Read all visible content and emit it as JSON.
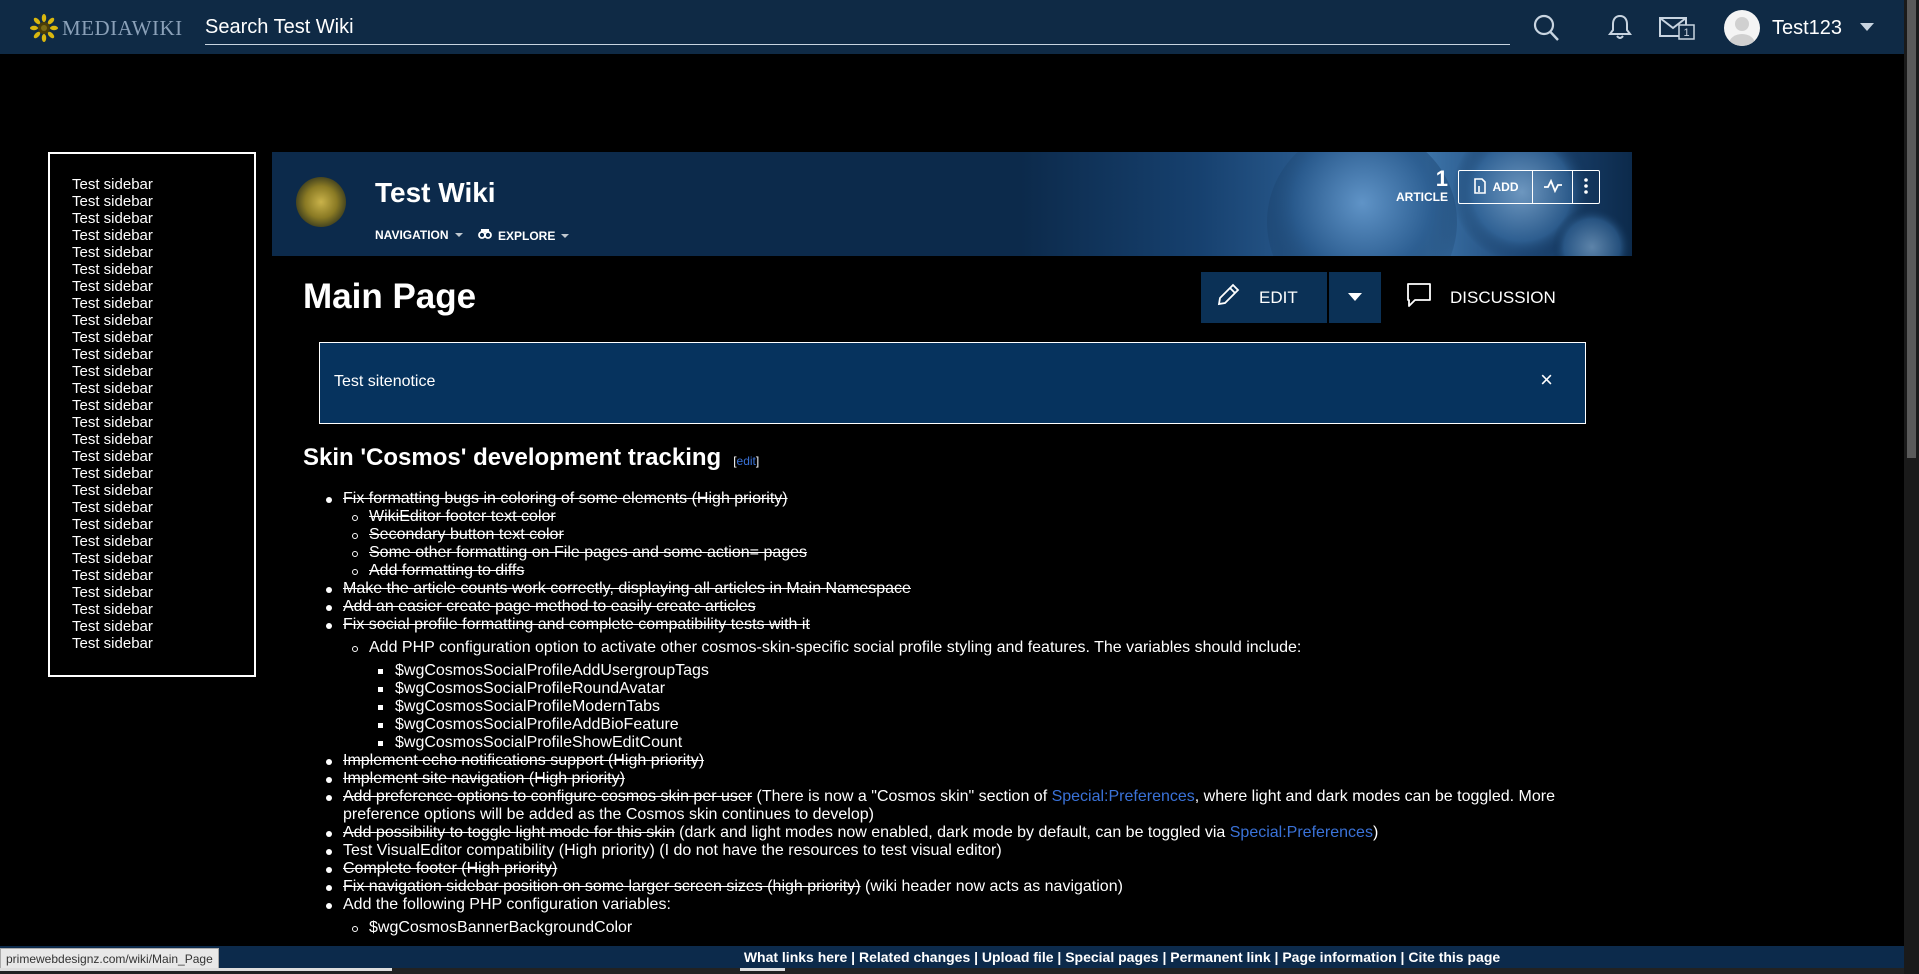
{
  "topbar": {
    "logo_text": "MEDIAWIKI",
    "search_placeholder": "Search Test Wiki",
    "username": "Test123",
    "notices_badge": "1",
    "icons": [
      "search-icon",
      "bell-icon",
      "mail-icon",
      "avatar",
      "chevron-down-icon"
    ]
  },
  "sidebar": {
    "items": [
      "Test sidebar",
      "Test sidebar",
      "Test sidebar",
      "Test sidebar",
      "Test sidebar",
      "Test sidebar",
      "Test sidebar",
      "Test sidebar",
      "Test sidebar",
      "Test sidebar",
      "Test sidebar",
      "Test sidebar",
      "Test sidebar",
      "Test sidebar",
      "Test sidebar",
      "Test sidebar",
      "Test sidebar",
      "Test sidebar",
      "Test sidebar",
      "Test sidebar",
      "Test sidebar",
      "Test sidebar",
      "Test sidebar",
      "Test sidebar",
      "Test sidebar",
      "Test sidebar",
      "Test sidebar",
      "Test sidebar"
    ]
  },
  "wiki_header": {
    "title": "Test Wiki",
    "nav_label": "NAVIGATION",
    "explore_label": "EXPLORE",
    "article_count": "1",
    "article_label": "ARTICLE",
    "add_label": "ADD"
  },
  "page": {
    "title": "Main Page",
    "edit_label": "EDIT",
    "discussion_label": "DISCUSSION",
    "sitenotice": "Test sitenotice",
    "notice_close": "×",
    "section_heading": "Skin 'Cosmos' development tracking",
    "editsection_open": "[",
    "editsection_link": "edit",
    "editsection_close": "]"
  },
  "content": {
    "items": [
      {
        "level": 1,
        "parts": [
          {
            "t": "Fix formatting bugs in coloring of some elements (High priority)",
            "s": true
          }
        ]
      },
      {
        "level": 2,
        "parts": [
          {
            "t": "WikiEditor footer text color",
            "s": true
          }
        ]
      },
      {
        "level": 2,
        "parts": [
          {
            "t": "Secondary button text color",
            "s": true
          }
        ]
      },
      {
        "level": 2,
        "parts": [
          {
            "t": "Some other formatting on File pages and some action= pages",
            "s": true
          }
        ]
      },
      {
        "level": 2,
        "parts": [
          {
            "t": "Add formatting to diffs",
            "s": true
          }
        ]
      },
      {
        "level": 1,
        "parts": [
          {
            "t": "Make the article counts work correctly, displaying all articles in Main Namespace",
            "s": true
          }
        ]
      },
      {
        "level": 1,
        "parts": [
          {
            "t": "Add an easier create page method to easily create articles",
            "s": true
          }
        ]
      },
      {
        "level": 1,
        "parts": [
          {
            "t": "Fix social profile formatting and complete compatibility tests with it",
            "s": true
          }
        ]
      },
      {
        "level": 2,
        "gap": true,
        "parts": [
          {
            "t": "Add PHP configuration option to activate other cosmos-skin-specific social profile styling and features. The variables should include:"
          }
        ]
      },
      {
        "level": 3,
        "gap": true,
        "parts": [
          {
            "t": "$wgCosmosSocialProfileAddUsergroupTags"
          }
        ]
      },
      {
        "level": 3,
        "parts": [
          {
            "t": "$wgCosmosSocialProfileRoundAvatar"
          }
        ]
      },
      {
        "level": 3,
        "parts": [
          {
            "t": "$wgCosmosSocialProfileModernTabs"
          }
        ]
      },
      {
        "level": 3,
        "parts": [
          {
            "t": "$wgCosmosSocialProfileAddBioFeature"
          }
        ]
      },
      {
        "level": 3,
        "parts": [
          {
            "t": "$wgCosmosSocialProfileShowEditCount"
          }
        ]
      },
      {
        "level": 1,
        "parts": [
          {
            "t": "Implement echo notifications support (High priority)",
            "s": true
          }
        ]
      },
      {
        "level": 1,
        "parts": [
          {
            "t": "Implement site navigation (High priority)",
            "s": true
          }
        ]
      },
      {
        "level": 1,
        "parts": [
          {
            "t": "Add preference options to configure cosmos skin per user",
            "s": true
          },
          {
            "t": " (There is now a \"Cosmos skin\" section of "
          },
          {
            "t": "Special:Preferences",
            "link": true
          },
          {
            "t": ", where light and dark modes can be toggled. More preference options will be added as the Cosmos skin continues to develop)"
          }
        ]
      },
      {
        "level": 1,
        "parts": [
          {
            "t": "Add possibility to toggle light mode for this skin",
            "s": true
          },
          {
            "t": " (dark and light modes now enabled, dark mode by default, can be toggled via "
          },
          {
            "t": "Special:Preferences",
            "link": true
          },
          {
            "t": ")"
          }
        ]
      },
      {
        "level": 1,
        "parts": [
          {
            "t": "Test VisualEditor compatibility (High priority) (I do not have the resources to test visual editor)"
          }
        ]
      },
      {
        "level": 1,
        "parts": [
          {
            "t": "Complete footer (High priority)",
            "s": true
          }
        ]
      },
      {
        "level": 1,
        "parts": [
          {
            "t": "Fix navigation sidebar position on some larger screen sizes (high priority)",
            "s": true
          },
          {
            "t": " (wiki header now acts as navigation)"
          }
        ]
      },
      {
        "level": 1,
        "parts": [
          {
            "t": "Add the following PHP configuration variables:"
          }
        ]
      },
      {
        "level": 2,
        "gap": true,
        "parts": [
          {
            "t": "$wgCosmosBannerBackgroundColor"
          }
        ]
      }
    ]
  },
  "footer": {
    "links": "What links here | Related changes | Upload file | Special pages | Permanent link | Page information | Cite this page",
    "status_url": "primewebdesignz.com/wiki/Main_Page"
  },
  "colors": {
    "topbar_bg": "#0f2a45",
    "header_bg": "#0c2a4b",
    "notice_bg": "#06335e",
    "edit_bg": "#0b3156",
    "link": "#3a72d8"
  }
}
